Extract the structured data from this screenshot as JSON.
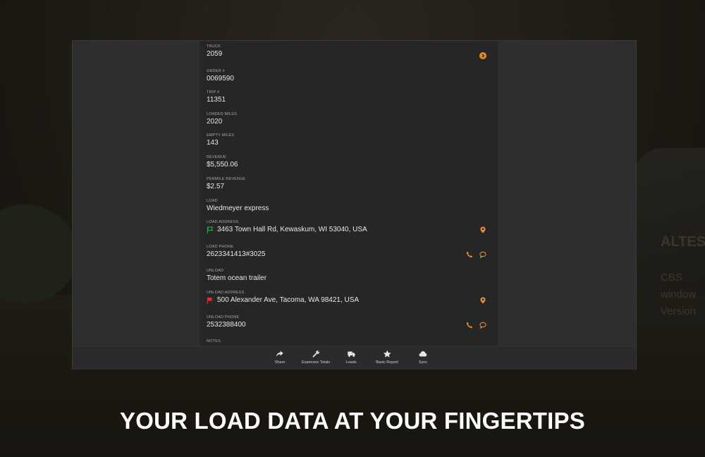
{
  "detail": {
    "fields": [
      {
        "label": "TRUCK",
        "value": "2059"
      },
      {
        "label": "ORDER #",
        "value": "0069590"
      },
      {
        "label": "TRIP #",
        "value": "11351"
      },
      {
        "label": "LOADED MILES",
        "value": "2020"
      },
      {
        "label": "EMPTY MILES",
        "value": "143"
      },
      {
        "label": "REVENUE",
        "value": "$5,550.06"
      },
      {
        "label": "PERMILE REVENUE",
        "value": "$2.57"
      },
      {
        "label": "LOAD",
        "value": "Wiedmeyer express"
      },
      {
        "label": "LOAD ADDRESS",
        "value": "3463 Town Hall Rd, Kewaskum, WI 53040, USA"
      },
      {
        "label": "LOAD PHONE",
        "value": "2623341413#3025"
      },
      {
        "label": "UNLOAD",
        "value": "Totem ocean trailer"
      },
      {
        "label": "UNLOAD ADDRESS",
        "value": "500 Alexander Ave, Tacoma, WA 98421, USA"
      },
      {
        "label": "UNLOAD PHONE",
        "value": "2532388400"
      },
      {
        "label": "NOTES",
        "value": ""
      }
    ]
  },
  "bottom_nav": [
    {
      "label": "Share",
      "icon": "share-icon"
    },
    {
      "label": "Expenses Totals",
      "icon": "wrench-icon"
    },
    {
      "label": "Loads",
      "icon": "truck-icon"
    },
    {
      "label": "Basic Report",
      "icon": "star-icon"
    },
    {
      "label": "Sync",
      "icon": "cloud-icon"
    }
  ],
  "headline": "YOUR LOAD DATA AT YOUR FINGERTIPS",
  "colors": {
    "accent": "#e8892b",
    "load_flag": "#2fae3a",
    "unload_flag": "#d6312a"
  }
}
